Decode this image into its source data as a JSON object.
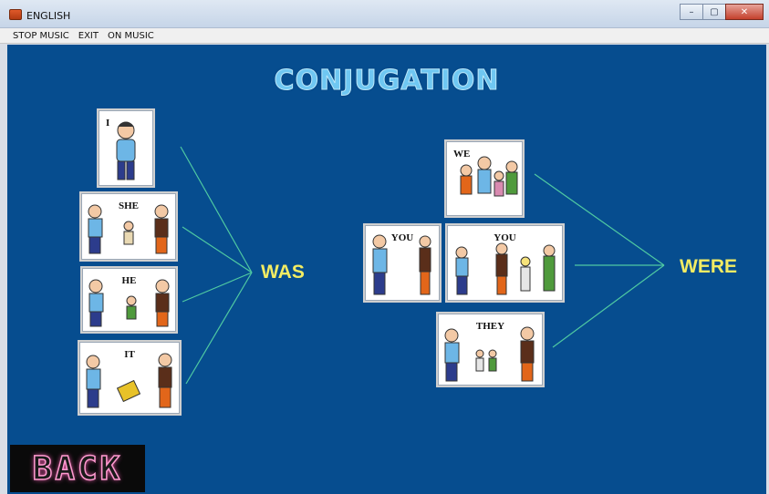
{
  "window": {
    "title": "ENGLISH",
    "minimize": "–",
    "maximize": "▢",
    "close": "✕"
  },
  "menu": [
    {
      "label": "STOP MUSIC"
    },
    {
      "label": "EXIT"
    },
    {
      "label": "ON MUSIC"
    }
  ],
  "heading": "CONJUGATION",
  "left_group": {
    "verb": "WAS",
    "cards": [
      {
        "pronoun": "I"
      },
      {
        "pronoun": "SHE"
      },
      {
        "pronoun": "HE"
      },
      {
        "pronoun": "IT"
      }
    ]
  },
  "right_group": {
    "verb": "WERE",
    "cards": [
      {
        "pronoun": "WE"
      },
      {
        "pronoun": "YOU"
      },
      {
        "pronoun": "YOU"
      },
      {
        "pronoun": "THEY"
      }
    ]
  },
  "back_button": {
    "label": "BACK"
  },
  "colors": {
    "background": "#064d8f",
    "heading": "#6fc7f2",
    "verb": "#f2ec63",
    "connector": "#4fc9a2",
    "back_glow": "#ff9ad0"
  }
}
